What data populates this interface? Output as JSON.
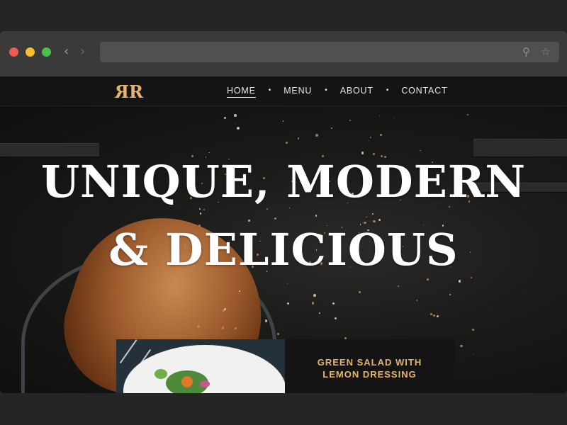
{
  "site": {
    "logo": "RR",
    "nav": [
      {
        "label": "HOME"
      },
      {
        "label": "MENU"
      },
      {
        "label": "ABOUT"
      },
      {
        "label": "CONTACT"
      }
    ],
    "active_nav": "HOME"
  },
  "hero": {
    "headline_line1": "UNIQUE, MODERN",
    "headline_line2": "& DELICIOUS"
  },
  "card": {
    "title_line1": "GREEN SALAD WITH",
    "title_line2": "LEMON DRESSING"
  },
  "browser": {
    "url": "",
    "icons": [
      "back-arrow-icon",
      "forward-arrow-icon",
      "search-icon",
      "star-icon"
    ]
  },
  "colors": {
    "accent": "#e5b56c",
    "header_bg": "#141414",
    "browser_chrome": "#3a3a3a"
  }
}
